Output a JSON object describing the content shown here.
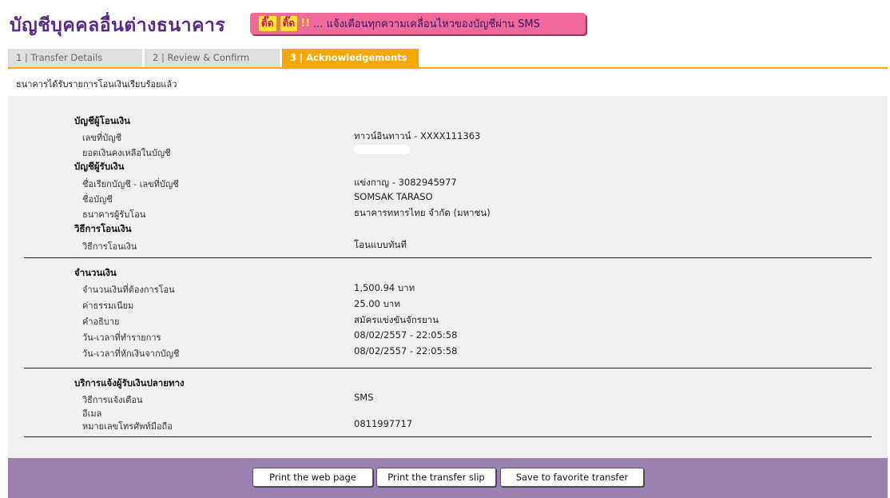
{
  "header": {
    "title": "บัญชีบุคคลอื่นต่างธนาคาร",
    "sms_banner": {
      "hot1": "ติ๊ด",
      "hot2": "ติ๊ด",
      "bang": "!!",
      "text": "... แจ้งเตือนทุกความเคลื่อนไหวของบัญชีผ่าน SMS"
    }
  },
  "tabs": [
    {
      "label": "1 | Transfer Details"
    },
    {
      "label": "2 | Review & Confirm"
    },
    {
      "label": "3 | Acknowledgements"
    }
  ],
  "ack_message": "ธนาคารได้รับรายการโอนเงินเรียบร้อยแล้ว",
  "from_account": {
    "heading": "บัญชีผู้โอนเงิน",
    "account_no_label": "เลขที่บัญชี",
    "account_no_value": "ทาวน์อินทาวน์ - XXXX111363",
    "balance_label": "ยอดเงินคงเหลือในบัญชี"
  },
  "to_account": {
    "heading": "บัญชีผู้รับเงิน",
    "nickname_label": "ชื่อเรียกบัญชี - เลขที่บัญชี",
    "nickname_value": "แข่งกาญ - 3082945977",
    "name_label": "ชื่อบัญชี",
    "name_value": "SOMSAK TARASO",
    "bank_label": "ธนาคารผู้รับโอน",
    "bank_value": "ธนาคารทหารไทย จำกัด (มหาชน)"
  },
  "method": {
    "heading": "วิธีการโอนเงิน",
    "label": "วิธีการโอนเงิน",
    "value": "โอนแบบทันที"
  },
  "amount": {
    "heading": "จำนวนเงิน",
    "transfer_label": "จำนวนเงินที่ต้องการโอน",
    "transfer_value": "1,500.94 บาท",
    "fee_label": "ค่าธรรมเนียม",
    "fee_value": "25.00  บาท",
    "desc_label": "คำอธิบาย",
    "desc_value": "สมัครแข่งขันจักรยาน",
    "txn_time_label": "วัน-เวลาที่ทำรายการ",
    "txn_time_value": "08/02/2557 - 22:05:58",
    "debit_time_label": "วัน-เวลาที่หักเงินจากบัญชี",
    "debit_time_value": "08/02/2557 - 22:05:58"
  },
  "notify": {
    "heading": "บริการแจ้งผู้รับเงินปลายทาง",
    "method_label": "วิธีการแจ้งเตือน",
    "method_value": "SMS",
    "email_label": "อีเมล",
    "phone_label": "หมายเลขโทรศัพท์มือถือ",
    "phone_value": "0811997717"
  },
  "buttons": {
    "print_page": "Print the web page",
    "print_slip": "Print the transfer slip",
    "save_favorite": "Save to favorite transfer"
  },
  "colors": {
    "title_purple": "#5b2a86",
    "tab_active": "#f7a800",
    "banner_pink": "#ef6a9a",
    "action_bar": "#9a82b0"
  }
}
